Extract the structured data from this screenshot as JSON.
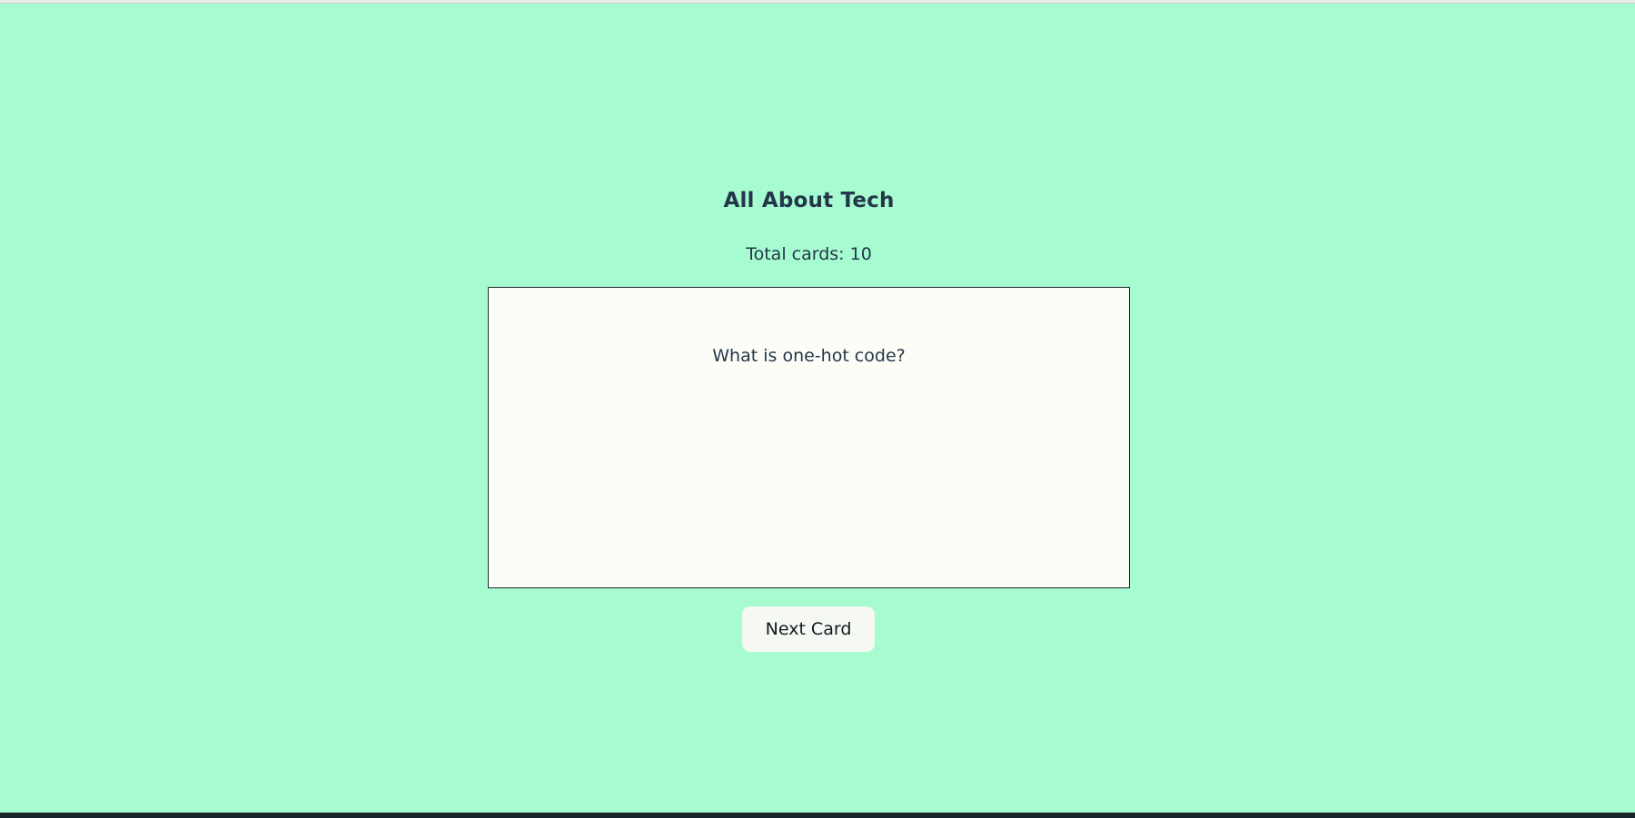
{
  "app": {
    "title": "All About Tech",
    "total_cards_text": "Total cards: 10"
  },
  "card": {
    "question": "What is one-hot code?"
  },
  "controls": {
    "next_label": "Next Card"
  },
  "colors": {
    "background": "#a6fbd0",
    "card_background": "#fdfdf8",
    "text": "#24364a",
    "button_background": "#f6f8f3"
  }
}
